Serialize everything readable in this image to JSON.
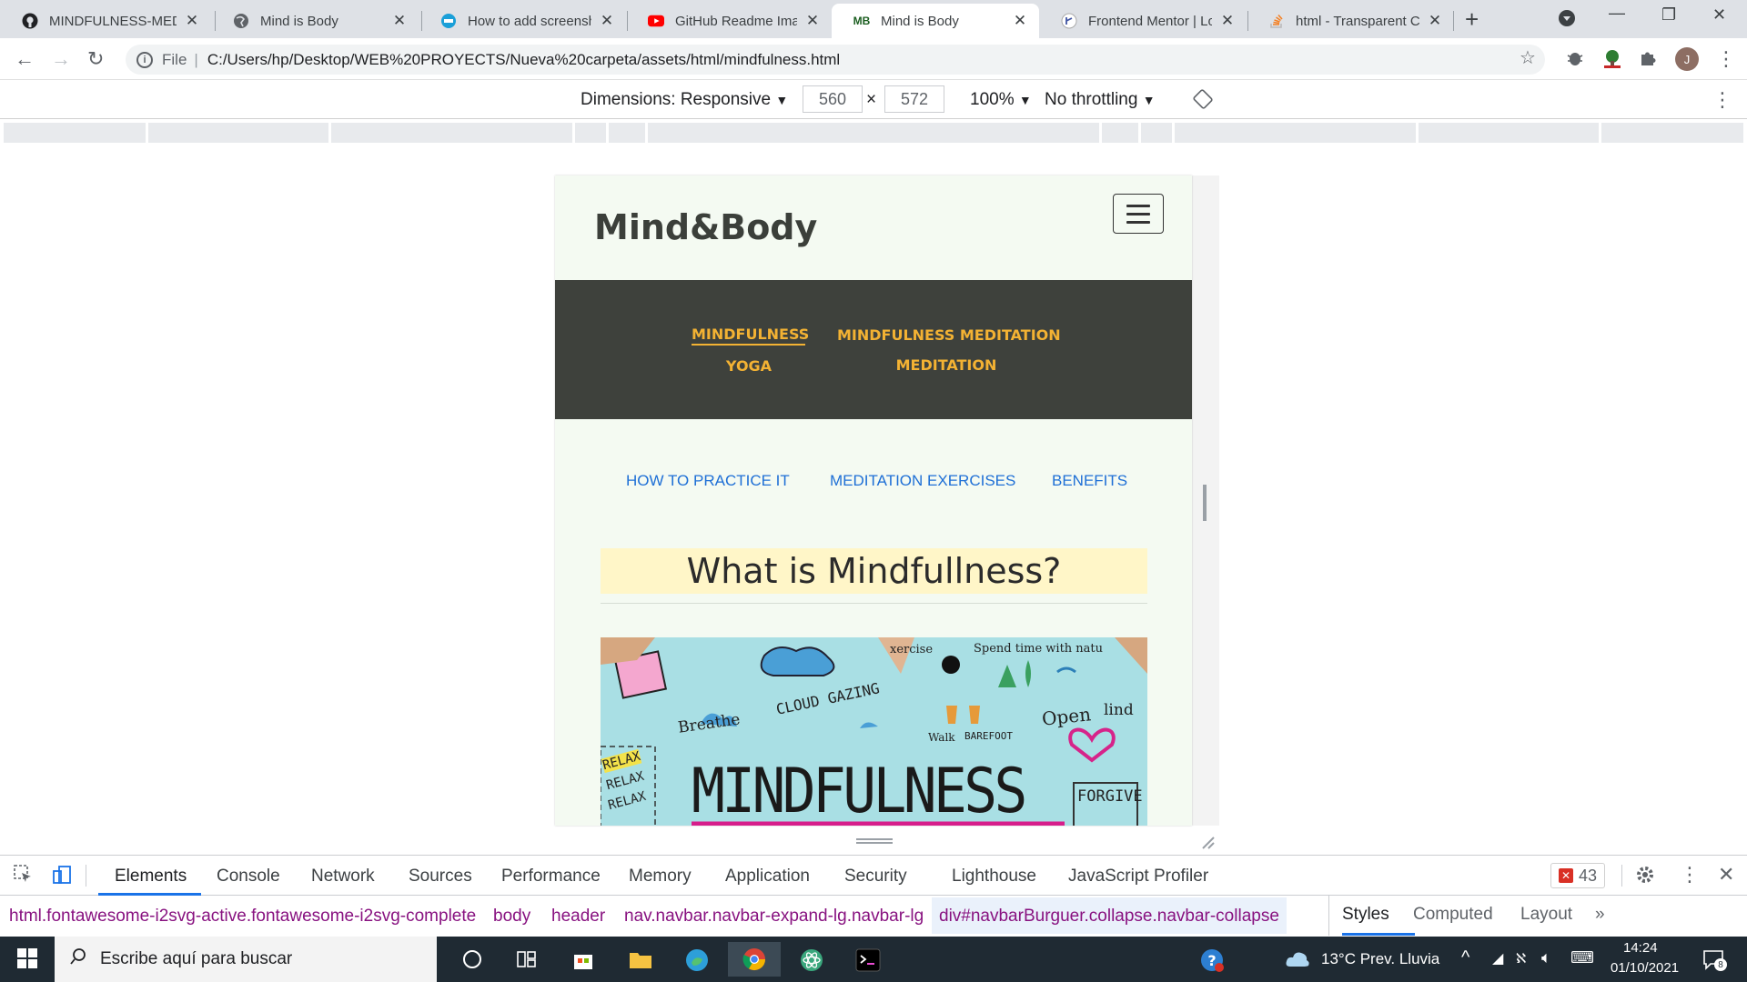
{
  "tabs": [
    {
      "title": "MINDFULNESS-MEDIT",
      "favicon": "github-icon"
    },
    {
      "title": "Mind is Body",
      "favicon": "globe-icon"
    },
    {
      "title": "How to add screensho",
      "favicon": "globe-icon"
    },
    {
      "title": "GitHub Readme Image",
      "favicon": "youtube-icon"
    },
    {
      "title": "Mind is Body",
      "favicon": "MB",
      "active": true
    },
    {
      "title": "Frontend Mentor | Lo",
      "favicon": "frontendmentor-icon"
    },
    {
      "title": "html - Transparent CS",
      "favicon": "stackoverflow-icon"
    }
  ],
  "address": {
    "scheme_label": "File",
    "url": "C:/Users/hp/Desktop/WEB%20PROYECTS/Nueva%20carpeta/assets/html/mindfulness.html"
  },
  "device_toolbar": {
    "dimensions_label": "Dimensions: Responsive",
    "width": "560",
    "times": "×",
    "height": "572",
    "zoom": "100%",
    "throttling": "No throttling"
  },
  "site": {
    "brand": "Mind&Body",
    "nav": {
      "mindfulness": "MINDFULNESS",
      "yoga": "YOGA",
      "mindfulness_meditation": "MINDFULNESS MEDITATION",
      "meditation": "MEDITATION"
    },
    "subnav": [
      "HOW TO PRACTICE IT",
      "MEDITATION EXERCISES",
      "BENEFITS"
    ],
    "heading": "What is Mindfullness?",
    "hero_text": {
      "title": "MINDFULNESS",
      "breathe": "Breathe",
      "cloud": "CLOUD GAZING",
      "exercise": "xercise",
      "spend": "Spend time with natu",
      "walk": "Walk",
      "barefoot": "BAREFOOT",
      "open": "Open",
      "mind": "lind",
      "relax": "RELAX",
      "forgive": "FORGIVE"
    }
  },
  "devtools": {
    "tabs": [
      "Elements",
      "Console",
      "Network",
      "Sources",
      "Performance",
      "Memory",
      "Application",
      "Security",
      "Lighthouse",
      "JavaScript Profiler"
    ],
    "error_count": "43",
    "breadcrumbs": [
      "html.fontawesome-i2svg-active.fontawesome-i2svg-complete",
      "body",
      "header",
      "nav.navbar.navbar-expand-lg.navbar-lg",
      "div#navbarBurguer.collapse.navbar-collapse"
    ],
    "side_tabs": [
      "Styles",
      "Computed",
      "Layout"
    ]
  },
  "taskbar": {
    "search_placeholder": "Escribe aquí para buscar",
    "weather": "13°C  Prev. Lluvia",
    "time": "14:24",
    "date": "01/10/2021",
    "notifications": "8"
  }
}
